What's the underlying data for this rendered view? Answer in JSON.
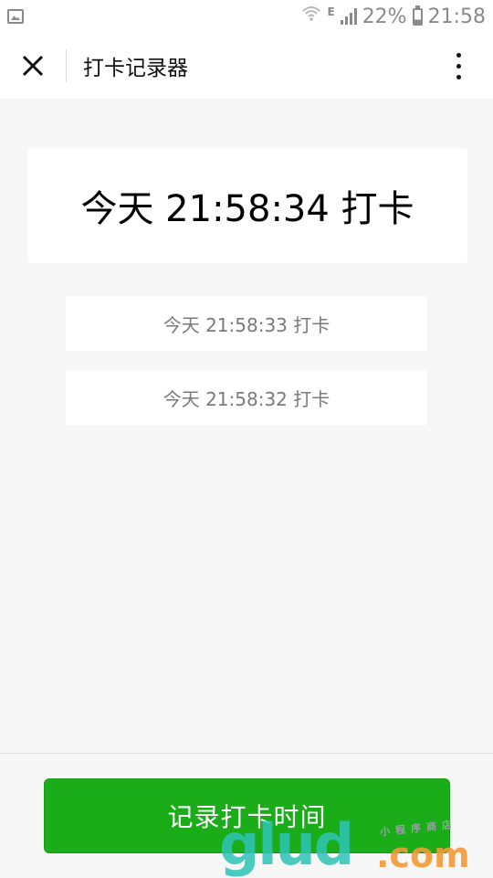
{
  "status_bar": {
    "battery_percent": "22%",
    "time": "21:58",
    "network_type": "E",
    "icons": [
      "image-icon",
      "wifi-icon",
      "signal-icon",
      "battery-icon"
    ]
  },
  "nav": {
    "title": "打卡记录器",
    "close_icon": "close-icon",
    "more_icon": "more-vertical-icon"
  },
  "latest_record": "今天 21:58:34 打卡",
  "records": [
    "今天 21:58:33 打卡",
    "今天 21:58:32 打卡"
  ],
  "action_button": {
    "label": "记录打卡时间",
    "color": "#1aad19"
  },
  "watermark": {
    "main": "glud",
    "suffix": ".com",
    "sub": "小程序商店"
  }
}
